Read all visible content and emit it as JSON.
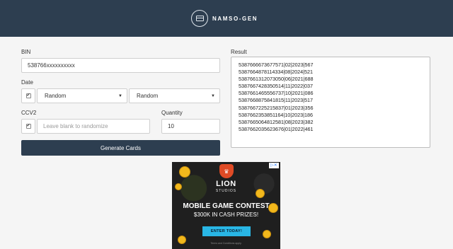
{
  "app": {
    "title": "NAMSO-GEN"
  },
  "colors": {
    "header_bg": "#2d3e50",
    "button_bg": "#2d3e50",
    "ad_cta": "#29b6e5",
    "ad_shield": "#e04b26"
  },
  "form": {
    "bin_label": "BIN",
    "bin_value": "538766xxxxxxxxxx",
    "date_label": "Date",
    "date_checkbox_checked": true,
    "month_select_value": "Random",
    "year_select_value": "Random",
    "ccv2_label": "CCV2",
    "ccv2_checkbox_checked": true,
    "ccv2_placeholder": "Leave blank to randomize",
    "quantity_label": "Quantity",
    "quantity_value": "10",
    "generate_button_label": "Generate Cards"
  },
  "result": {
    "label": "Result",
    "lines": [
      "5387666673677571|02|2023|567",
      "5387664878114334|08|2024|521",
      "5387661312073050|06|2021|688",
      "5387667428350514|11|2022|037",
      "5387661465556737|10|2021|086",
      "5387668875841815|11|2023|517",
      "5387667225215837|01|2023|356",
      "5387662353851164|10|2023|186",
      "5387665064812581|08|2023|382",
      "5387662035623676|01|2022|461"
    ]
  },
  "ad": {
    "brand": "LION",
    "studios": "STUDIOS",
    "headline": "MOBILE GAME CONTEST",
    "prize": "$300K IN CASH PRIZES!",
    "cta": "ENTER TODAY!",
    "terms": "Terms and Conditions apply."
  }
}
